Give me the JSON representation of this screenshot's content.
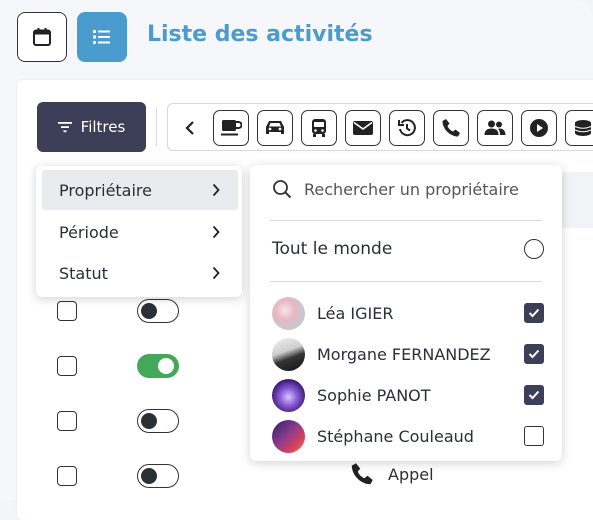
{
  "header": {
    "title": "Liste des activités",
    "calendar_icon": "calendar-icon",
    "list_icon": "list-icon",
    "accent": "#4a9ccf"
  },
  "filters": {
    "button_label": "Filtres",
    "menu": [
      {
        "label": "Propriétaire",
        "active": true
      },
      {
        "label": "Période"
      },
      {
        "label": "Statut"
      }
    ]
  },
  "toolbar": {
    "icons": [
      "coffee-icon",
      "car-icon",
      "bus-icon",
      "envelope-icon",
      "history-icon",
      "phone-icon",
      "users-icon",
      "play-icon",
      "coins-icon"
    ]
  },
  "owner_panel": {
    "search_placeholder": "Rechercher un propriétaire",
    "everyone_label": "Tout le monde",
    "people": [
      {
        "name": "Léa IGIER",
        "checked": true
      },
      {
        "name": "Morgane FERNANDEZ",
        "checked": true
      },
      {
        "name": "Sophie PANOT",
        "checked": true
      },
      {
        "name": "Stéphane Couleaud",
        "checked": false
      }
    ]
  },
  "rows": {
    "visible_type_label": "Appel",
    "toggles": [
      false,
      true,
      false,
      false
    ]
  },
  "colors": {
    "dark": "#3d3e57",
    "toggle_on": "#43a85a"
  }
}
